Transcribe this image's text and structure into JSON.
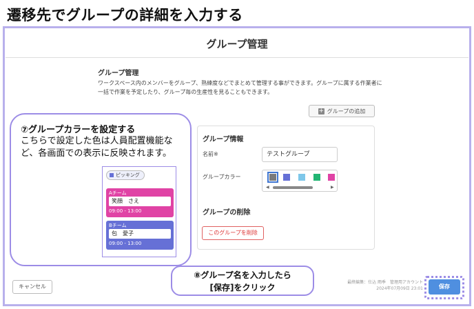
{
  "heading": "遷移先でグループの詳細を入力する",
  "topbar": {
    "title": "グループ管理"
  },
  "section": {
    "title": "グループ管理",
    "description": "ワークスペース内のメンバーをグループ、熟練度などでまとめて管理する事ができます。グループに属する作業者に一括で作業を予定したり、グループ毎の生産性を見ることもできます。"
  },
  "add_group_button": "グループの追加",
  "panel": {
    "info_title": "グループ情報",
    "name_label": "名前※",
    "name_value": "テストグループ",
    "color_label": "グループカラー",
    "delete_title": "グループの削除",
    "delete_button": "このグループを削除"
  },
  "swatch_colors": [
    "#7a7a7a",
    "#6670d6",
    "#7ec7ea",
    "#22b573",
    "#e043a5"
  ],
  "callout1": {
    "title": "⑦グループカラーを設定する",
    "body": "こちらで設定した色は人員配置機能など、各画面での表示に反映されます。"
  },
  "preview": {
    "tag": "ピッキング",
    "teams": [
      {
        "name": "Aチーム",
        "person": "笑顔　さえ",
        "time": "09:00 - 13:00",
        "color": "#e043a5"
      },
      {
        "name": "Bチーム",
        "person": "包　愛子",
        "time": "09:00 - 13:00",
        "color": "#6670d6"
      }
    ]
  },
  "footer": {
    "cancel": "キャンセル",
    "meta_line1": "最終編集：仕込 雨季　管理用アカウント",
    "meta_line2": "2024年07月09日 23:01",
    "save": "保存"
  },
  "callout2": {
    "line1": "⑧グループ名を入力したら",
    "line2": "[保存]をクリック"
  }
}
